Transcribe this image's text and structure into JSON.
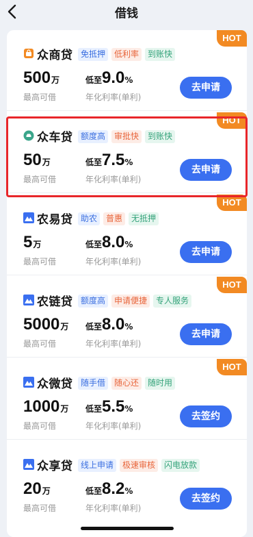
{
  "nav": {
    "title": "借钱",
    "back_icon": "chevron-left-icon"
  },
  "colors": {
    "accent": "#3a6ff0",
    "hot": "#f28a23",
    "highlight": "#e8262a"
  },
  "products": [
    {
      "name": "众商贷",
      "logo": "shop-bag-icon",
      "logo_color": "#f28a23",
      "hot": "HOT",
      "tags": [
        {
          "text": "免抵押",
          "style": "blue"
        },
        {
          "text": "低利率",
          "style": "red"
        },
        {
          "text": "到账快",
          "style": "green"
        }
      ],
      "amount": "500",
      "amount_unit": "万",
      "amount_label": "最高可借",
      "rate_prefix": "低至",
      "rate": "9.0",
      "rate_unit": "%",
      "rate_label": "年化利率(单利)",
      "action": "去申请"
    },
    {
      "name": "众车贷",
      "logo": "car-icon",
      "logo_color": "#3aa58a",
      "hot": "HOT",
      "tags": [
        {
          "text": "额度高",
          "style": "blue"
        },
        {
          "text": "审批快",
          "style": "red"
        },
        {
          "text": "到账快",
          "style": "green"
        }
      ],
      "amount": "50",
      "amount_unit": "万",
      "amount_label": "最高可借",
      "rate_prefix": "低至",
      "rate": "7.5",
      "rate_unit": "%",
      "rate_label": "年化利率(单利)",
      "action": "去申请"
    },
    {
      "name": "农易贷",
      "logo": "mountain-icon",
      "logo_color": "#3a6ff0",
      "hot": "HOT",
      "tags": [
        {
          "text": "助农",
          "style": "blue"
        },
        {
          "text": "普惠",
          "style": "red"
        },
        {
          "text": "无抵押",
          "style": "green"
        }
      ],
      "amount": "5",
      "amount_unit": "万",
      "amount_label": "最高可借",
      "rate_prefix": "低至",
      "rate": "8.0",
      "rate_unit": "%",
      "rate_label": "年化利率(单利)",
      "action": "去申请"
    },
    {
      "name": "农链贷",
      "logo": "mountain-icon",
      "logo_color": "#3a6ff0",
      "hot": "HOT",
      "tags": [
        {
          "text": "额度高",
          "style": "blue"
        },
        {
          "text": "申请便捷",
          "style": "red"
        },
        {
          "text": "专人服务",
          "style": "green"
        }
      ],
      "amount": "5000",
      "amount_unit": "万",
      "amount_label": "最高可借",
      "rate_prefix": "低至",
      "rate": "8.0",
      "rate_unit": "%",
      "rate_label": "年化利率(单利)",
      "action": "去申请"
    },
    {
      "name": "众微贷",
      "logo": "mountain-icon",
      "logo_color": "#3a6ff0",
      "hot": "HOT",
      "tags": [
        {
          "text": "随手借",
          "style": "blue"
        },
        {
          "text": "随心还",
          "style": "red"
        },
        {
          "text": "随时用",
          "style": "green"
        }
      ],
      "amount": "1000",
      "amount_unit": "万",
      "amount_label": "最高可借",
      "rate_prefix": "低至",
      "rate": "5.5",
      "rate_unit": "%",
      "rate_label": "年化利率(单利)",
      "action": "去签约"
    },
    {
      "name": "众享贷",
      "logo": "mountain-icon",
      "logo_color": "#3a6ff0",
      "hot": "",
      "tags": [
        {
          "text": "线上申请",
          "style": "blue"
        },
        {
          "text": "极速审核",
          "style": "red"
        },
        {
          "text": "闪电放款",
          "style": "green"
        }
      ],
      "amount": "20",
      "amount_unit": "万",
      "amount_label": "最高可借",
      "rate_prefix": "低至",
      "rate": "8.2",
      "rate_unit": "%",
      "rate_label": "年化利率(单利)",
      "action": "去签约"
    }
  ]
}
